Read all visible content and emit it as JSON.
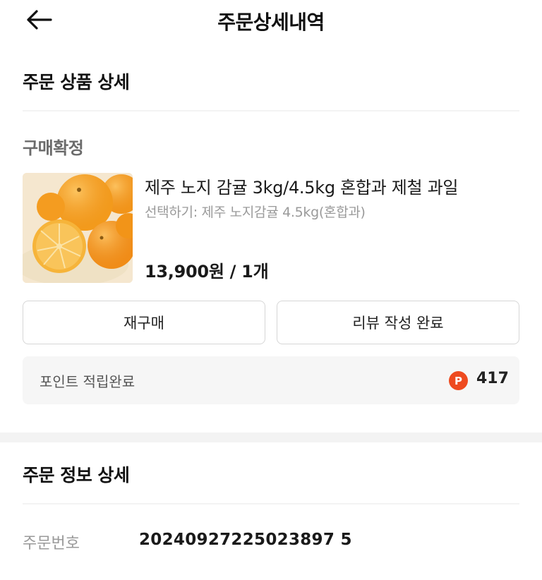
{
  "header": {
    "title": "주문상세내역",
    "back_icon": "arrow-left-icon"
  },
  "product_section": {
    "title": "주문 상품 상세",
    "status": "구매확정",
    "product": {
      "name": "제주 노지 감귤 3kg/4.5kg 혼합과 제철 과일",
      "option": "선택하기: 제주 노지감귤 4.5kg(혼합과)",
      "price": "13,900원 / 1개"
    },
    "buttons": {
      "rebuy": "재구매",
      "review": "리뷰 작성 완료"
    },
    "points": {
      "label": "포인트 적립완료",
      "badge": "P",
      "value": "417",
      "badge_color": "#ee4a1f"
    }
  },
  "order_info_section": {
    "title": "주문 정보 상세",
    "order_number_label": "주문번호",
    "order_number": "20240927225023897 5"
  }
}
